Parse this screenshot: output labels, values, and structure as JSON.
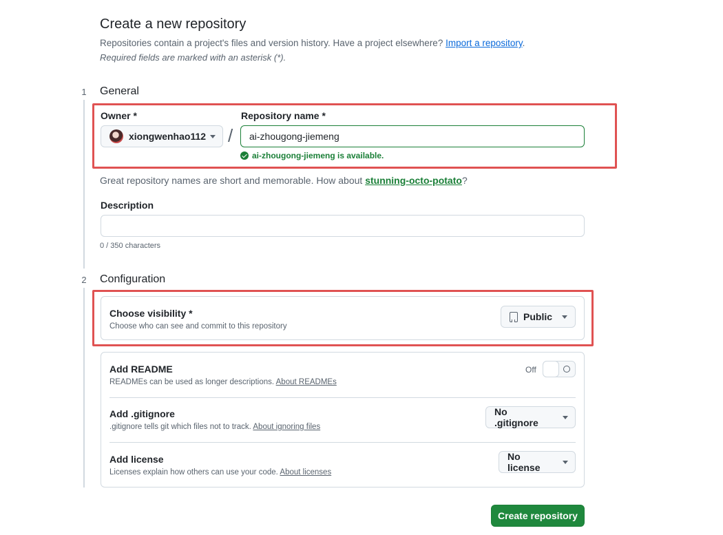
{
  "page": {
    "title": "Create a new repository",
    "subtitle_prefix": "Repositories contain a project's files and version history. Have a project elsewhere?",
    "import_link": "Import a repository",
    "subtitle_suffix": ".",
    "required_note": "Required fields are marked with an asterisk (*)."
  },
  "general": {
    "step": "1",
    "title": "General",
    "owner_label": "Owner *",
    "owner_value": "xiongwenhao112",
    "separator": "/",
    "repo_name_label": "Repository name *",
    "repo_name_value": "ai-zhougong-jiemeng",
    "availability": "ai-zhougong-jiemeng is available.",
    "hint_prefix": "Great repository names are short and memorable. How about",
    "hint_suggestion": "stunning-octo-potato",
    "hint_suffix": "?",
    "description_label": "Description",
    "description_value": "",
    "char_count": "0 / 350 characters"
  },
  "configuration": {
    "step": "2",
    "title": "Configuration",
    "visibility_title": "Choose visibility *",
    "visibility_desc": "Choose who can see and commit to this repository",
    "visibility_value": "Public",
    "readme_title": "Add README",
    "readme_desc": "READMEs can be used as longer descriptions.",
    "readme_link": "About READMEs",
    "readme_toggle_label": "Off",
    "gitignore_title": "Add .gitignore",
    "gitignore_desc": ".gitignore tells git which files not to track.",
    "gitignore_link": "About ignoring files",
    "gitignore_value": "No .gitignore",
    "license_title": "Add license",
    "license_desc": "Licenses explain how others can use your code.",
    "license_link": "About licenses",
    "license_value": "No license"
  },
  "actions": {
    "create_label": "Create repository"
  },
  "colors": {
    "primary_button": "#1f883d",
    "success_text": "#1a7f37",
    "link": "#0969da",
    "highlight_box": "#e05252"
  }
}
